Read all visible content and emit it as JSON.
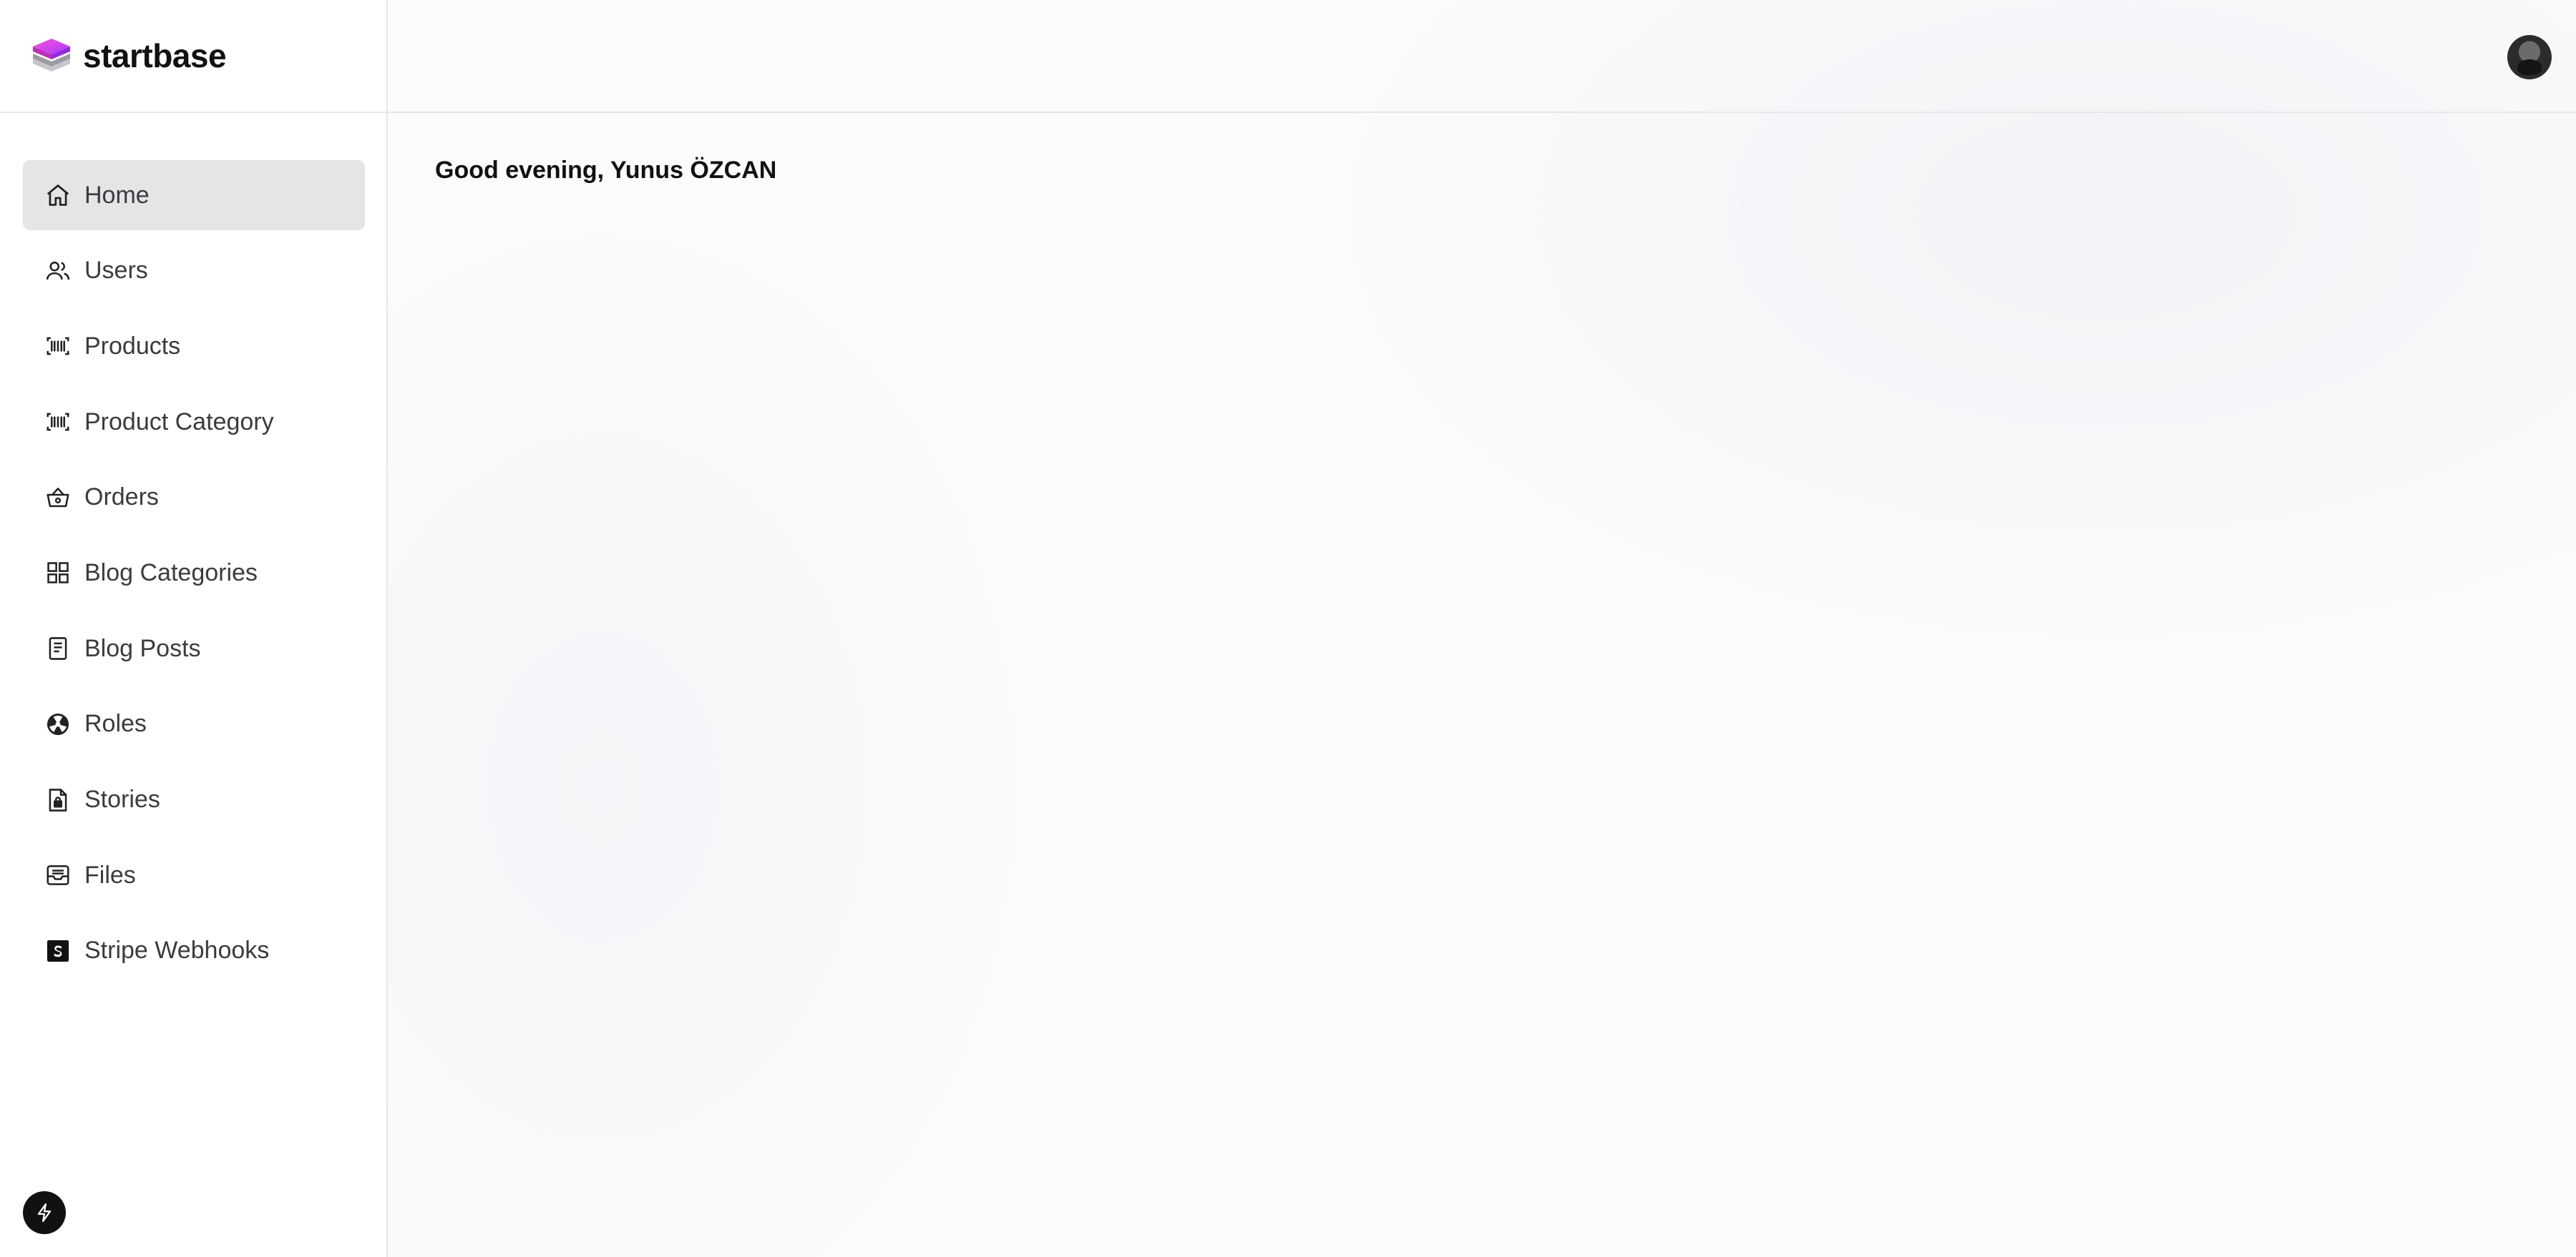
{
  "brand": {
    "name": "startbase",
    "logo_icon": "layers-icon"
  },
  "sidebar": {
    "items": [
      {
        "label": "Home",
        "icon": "home-icon",
        "active": true
      },
      {
        "label": "Users",
        "icon": "users-icon"
      },
      {
        "label": "Products",
        "icon": "barcode-icon"
      },
      {
        "label": "Product Category",
        "icon": "barcode-icon"
      },
      {
        "label": "Orders",
        "icon": "basket-icon"
      },
      {
        "label": "Blog Categories",
        "icon": "grid-icon"
      },
      {
        "label": "Blog Posts",
        "icon": "document-icon"
      },
      {
        "label": "Roles",
        "icon": "roles-icon"
      },
      {
        "label": "Stories",
        "icon": "file-lock-icon"
      },
      {
        "label": "Files",
        "icon": "inbox-icon"
      },
      {
        "label": "Stripe Webhooks",
        "icon": "stripe-icon"
      }
    ],
    "footer_icon": "bolt-icon"
  },
  "header": {
    "avatar_icon": "user-avatar"
  },
  "main": {
    "greeting": "Good evening, Yunus ÖZCAN"
  },
  "colors": {
    "active_item_bg": "#e5e5e8",
    "brand_magenta": "#e040c8",
    "brand_purple": "#9b4dff"
  }
}
